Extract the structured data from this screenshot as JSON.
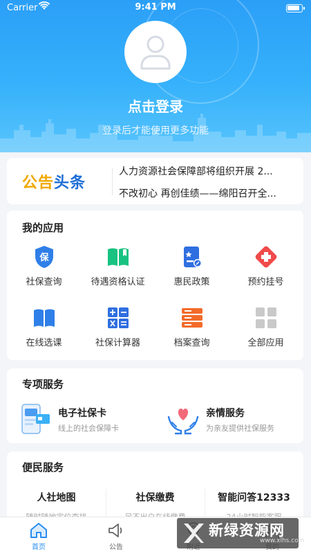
{
  "status_bar": {
    "carrier": "Carrier",
    "time": "9:41 PM"
  },
  "header": {
    "login_title": "点击登录",
    "login_subtitle": "登录后才能使用更多功能"
  },
  "notice": {
    "logo_part1": "公告",
    "logo_part2": "头条",
    "headlines": [
      "人力资源社会保障部将组织开展 2...",
      "不改初心 再创佳绩——绵阳召开全..."
    ]
  },
  "my_apps": {
    "title": "我的应用",
    "items": [
      {
        "label": "社保查询",
        "icon": "shield-bao-icon"
      },
      {
        "label": "待遇资格认证",
        "icon": "book-bookmark-icon"
      },
      {
        "label": "惠民政策",
        "icon": "policy-doc-icon"
      },
      {
        "label": "预约挂号",
        "icon": "medical-cross-icon"
      },
      {
        "label": "在线选课",
        "icon": "open-book-icon"
      },
      {
        "label": "社保计算器",
        "icon": "calculator-icon"
      },
      {
        "label": "档案查询",
        "icon": "archive-server-icon"
      },
      {
        "label": "全部应用",
        "icon": "grid-apps-icon"
      }
    ]
  },
  "special_services": {
    "title": "专项服务",
    "items": [
      {
        "title": "电子社保卡",
        "subtitle": "线上的社会保障卡",
        "icon": "phone-card-icon"
      },
      {
        "title": "亲情服务",
        "subtitle": "为亲友提供社保服务",
        "icon": "hands-heart-icon"
      }
    ]
  },
  "convenience": {
    "title": "便民服务",
    "items": [
      {
        "title": "人社地图",
        "subtitle": "随时随地定位查找"
      },
      {
        "title": "社保缴费",
        "subtitle": "足不出户在线缴费"
      },
      {
        "title": "智能问答12333",
        "subtitle": "24小时智能客服"
      }
    ]
  },
  "tabbar": {
    "items": [
      {
        "label": "首页",
        "icon": "home-icon",
        "active": true
      },
      {
        "label": "公告",
        "icon": "megaphone-icon",
        "active": false
      },
      {
        "label": "附近",
        "icon": "location-icon",
        "active": false
      },
      {
        "label": "我的",
        "icon": "user-icon",
        "active": false
      }
    ]
  },
  "watermark": {
    "text": "新绿资源网",
    "url": "www.xlhs.com"
  },
  "colors": {
    "primary": "#2a8ef0",
    "hero_top": "#2b9ff7",
    "logo_orange": "#f0a800",
    "logo_blue": "#1f6fd6"
  }
}
